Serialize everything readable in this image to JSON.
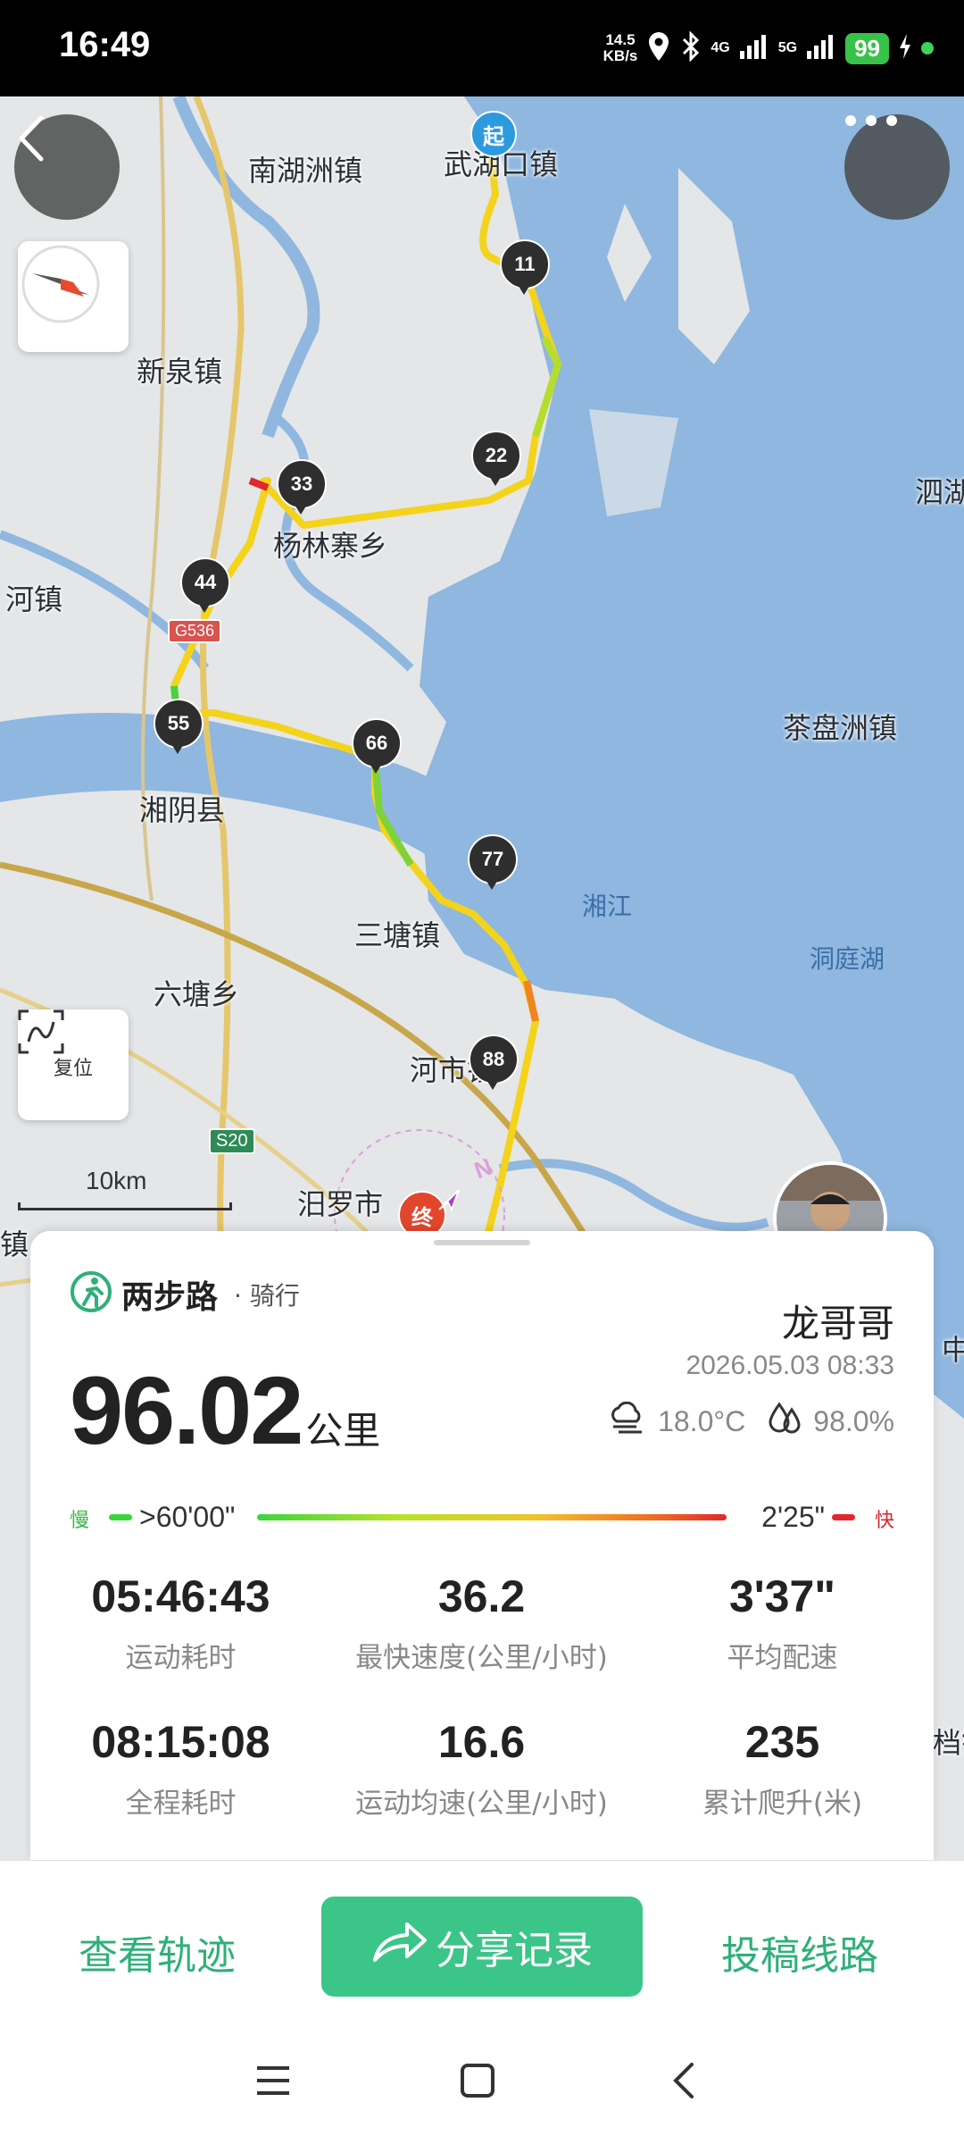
{
  "status_bar": {
    "time": "16:49",
    "net_speed_top": "14.5",
    "net_speed_bottom": "KB/s",
    "signal_1": "4G",
    "signal_2": "5G",
    "battery": "99"
  },
  "map": {
    "towns": [
      "南湖洲镇",
      "武湖口镇",
      "新泉镇",
      "杨林寨乡",
      "河镇",
      "湘阴县",
      "三塘镇",
      "六塘乡",
      "河市镇",
      "汨罗市",
      "茶盘洲镇",
      "泗湖",
      "中",
      "镇",
      "档铺"
    ],
    "water_labels": [
      "湘江",
      "洞庭湖"
    ],
    "start_label": "起",
    "end_label": "终",
    "markers": [
      "11",
      "22",
      "33",
      "44",
      "55",
      "66",
      "77",
      "88"
    ],
    "roads": [
      "G536",
      "S20"
    ],
    "scale": "10km",
    "compass_letter": "N",
    "reset_label": "复位"
  },
  "card": {
    "brand_name": "两步路",
    "activity_type": "· 骑行",
    "user_name": "龙哥哥",
    "date": "2026.05.03 08:33",
    "distance_value": "96.02",
    "distance_unit": "公里",
    "temperature": "18.0°C",
    "humidity": "98.0%",
    "pace_slow_label": "慢",
    "pace_fast_label": "快",
    "pace_slow_value": ">60'00\"",
    "pace_fast_value": "2'25\"",
    "stats": [
      {
        "value": "05:46:43",
        "label": "运动耗时"
      },
      {
        "value": "36.2",
        "label": "最快速度(公里/小时)"
      },
      {
        "value": "3'37\"",
        "label": "平均配速"
      },
      {
        "value": "08:15:08",
        "label": "全程耗时"
      },
      {
        "value": "16.6",
        "label": "运动均速(公里/小时)"
      },
      {
        "value": "235",
        "label": "累计爬升(米)"
      }
    ]
  },
  "actions": {
    "view_track": "查看轨迹",
    "share_record": "分享记录",
    "submit_route": "投稿线路"
  }
}
